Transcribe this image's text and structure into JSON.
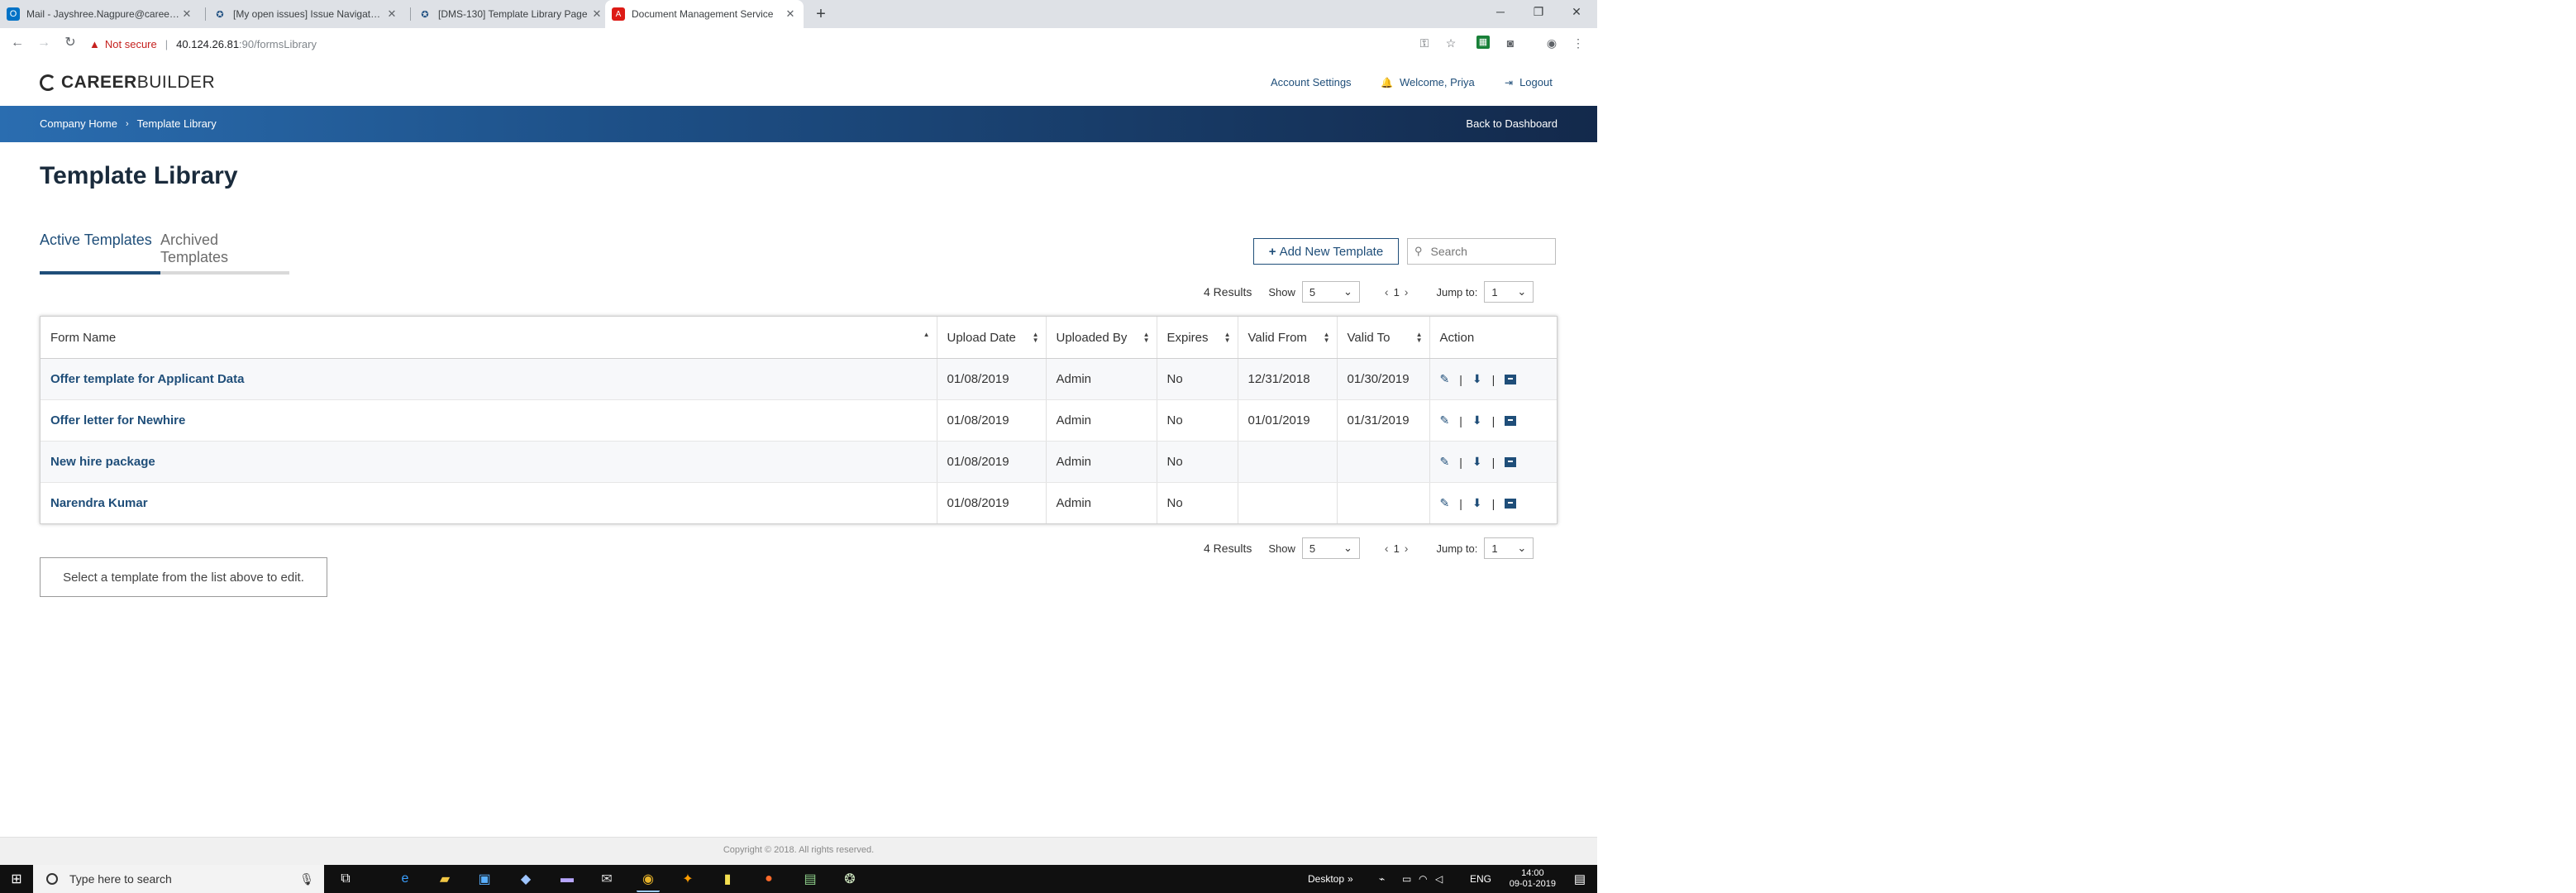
{
  "browser": {
    "tabs": [
      {
        "title": "Mail - Jayshree.Nagpure@careerbui",
        "icon": "outlook-icon",
        "color": "#0072c6"
      },
      {
        "title": "[My open issues] Issue Navigator -",
        "icon": "jira-icon",
        "color": "#205081"
      },
      {
        "title": "[DMS-130] Template Library Page",
        "icon": "jira-icon",
        "color": "#205081"
      },
      {
        "title": "Document Management Service",
        "icon": "angular-icon",
        "color": "#dd1b16"
      }
    ],
    "new_tab": "+",
    "address": {
      "security_label": "Not secure",
      "host": "40.124.26.81",
      "path": ":90/formsLibrary"
    }
  },
  "app": {
    "logo_bold": "CAREER",
    "logo_light": "BUILDER",
    "account_settings": "Account Settings",
    "welcome": "Welcome, Priya",
    "logout": "Logout",
    "breadcrumb": {
      "home": "Company Home",
      "current": "Template Library"
    },
    "back_to_dashboard": "Back to Dashboard"
  },
  "page": {
    "title": "Template Library",
    "tabs": [
      {
        "label": "Active Templates",
        "active": true
      },
      {
        "label": "Archived Templates",
        "active": false
      }
    ],
    "add_button": "Add New Template",
    "search_placeholder": "Search"
  },
  "pagination": {
    "results": "4 Results",
    "show_label": "Show",
    "show_value": "5",
    "page": "1",
    "jump_label": "Jump to:",
    "jump_value": "1"
  },
  "table": {
    "columns": [
      "Form Name",
      "Upload Date",
      "Uploaded By",
      "Expires",
      "Valid From",
      "Valid To",
      "Action"
    ],
    "rows": [
      {
        "name": "Offer template for Applicant Data",
        "upload_date": "01/08/2019",
        "uploaded_by": "Admin",
        "expires": "No",
        "valid_from": "12/31/2018",
        "valid_to": "01/30/2019"
      },
      {
        "name": "Offer letter for Newhire",
        "upload_date": "01/08/2019",
        "uploaded_by": "Admin",
        "expires": "No",
        "valid_from": "01/01/2019",
        "valid_to": "01/31/2019"
      },
      {
        "name": "New hire package",
        "upload_date": "01/08/2019",
        "uploaded_by": "Admin",
        "expires": "No",
        "valid_from": "",
        "valid_to": ""
      },
      {
        "name": "Narendra Kumar",
        "upload_date": "01/08/2019",
        "uploaded_by": "Admin",
        "expires": "No",
        "valid_from": "",
        "valid_to": ""
      }
    ]
  },
  "hint": "Select a template from the list above to edit.",
  "footer": "Copyright © 2018. All rights reserved.",
  "taskbar": {
    "search_placeholder": "Type here to search",
    "desktop_label": "Desktop",
    "language": "ENG",
    "time": "14:00",
    "date": "09-01-2019"
  },
  "colors": {
    "brand_blue": "#1f4e79",
    "bar_start": "#2a6db0",
    "bar_end": "#13294b"
  }
}
